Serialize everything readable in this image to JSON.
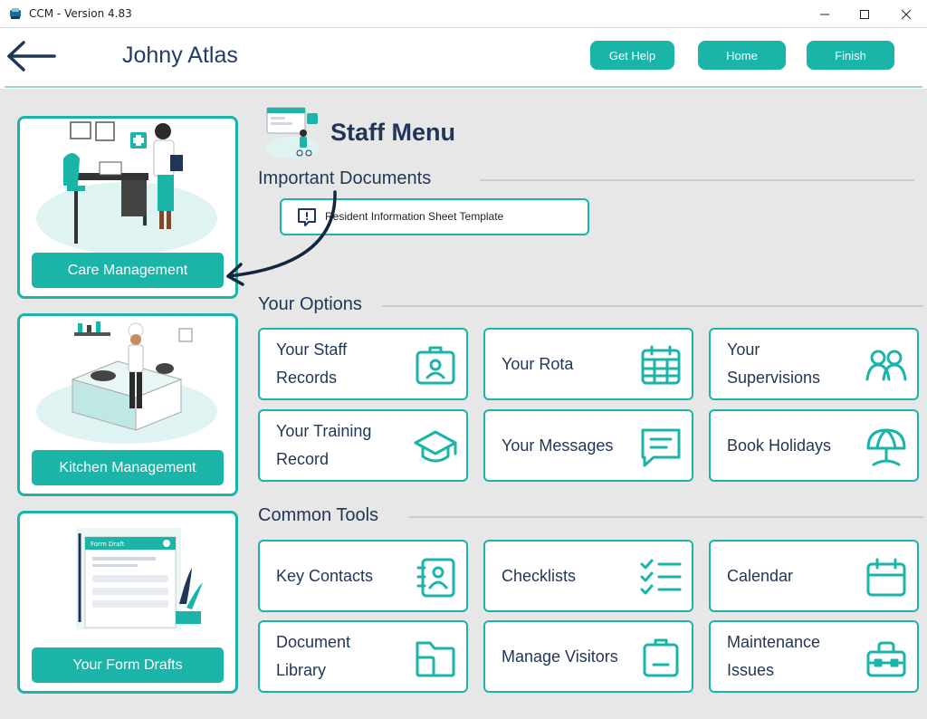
{
  "window": {
    "title": "CCM - Version 4.83",
    "minimize": "minimize-icon",
    "maximize": "maximize-icon",
    "close": "close-icon"
  },
  "header": {
    "back_icon": "back-arrow-icon",
    "user_name": "Johny Atlas",
    "get_help": "Get Help",
    "home": "Home",
    "finish": "Finish"
  },
  "sidebar": {
    "care": "Care Management",
    "kitchen": "Kitchen Management",
    "drafts": "Your Form Drafts",
    "form_draft_label": "Form Draft"
  },
  "main": {
    "title": "Staff Menu",
    "important_documents": "Important Documents",
    "document_1": "Resident Information Sheet Template",
    "your_options": "Your Options",
    "common_tools": "Common Tools"
  },
  "options": [
    {
      "label": "Your Staff\nRecords",
      "icon": "id-badge-icon"
    },
    {
      "label": "Your Rota",
      "icon": "calendar-grid-icon"
    },
    {
      "label": "Your\nSupervisions",
      "icon": "users-icon"
    },
    {
      "label": "Your Training\nRecord",
      "icon": "graduation-cap-icon"
    },
    {
      "label": "Your Messages",
      "icon": "message-icon"
    },
    {
      "label": "Book Holidays",
      "icon": "beach-umbrella-icon"
    }
  ],
  "tools": [
    {
      "label": "Key Contacts",
      "icon": "contacts-book-icon"
    },
    {
      "label": "Checklists",
      "icon": "checklist-icon"
    },
    {
      "label": "Calendar",
      "icon": "calendar-icon"
    },
    {
      "label": "Document\nLibrary",
      "icon": "folder-icon"
    },
    {
      "label": "Manage Visitors",
      "icon": "visitor-badge-icon"
    },
    {
      "label": "Maintenance\nIssues",
      "icon": "toolbox-icon"
    }
  ],
  "colors": {
    "accent": "#1ab4a8",
    "text": "#1f3656",
    "background": "#e7e7e7"
  }
}
